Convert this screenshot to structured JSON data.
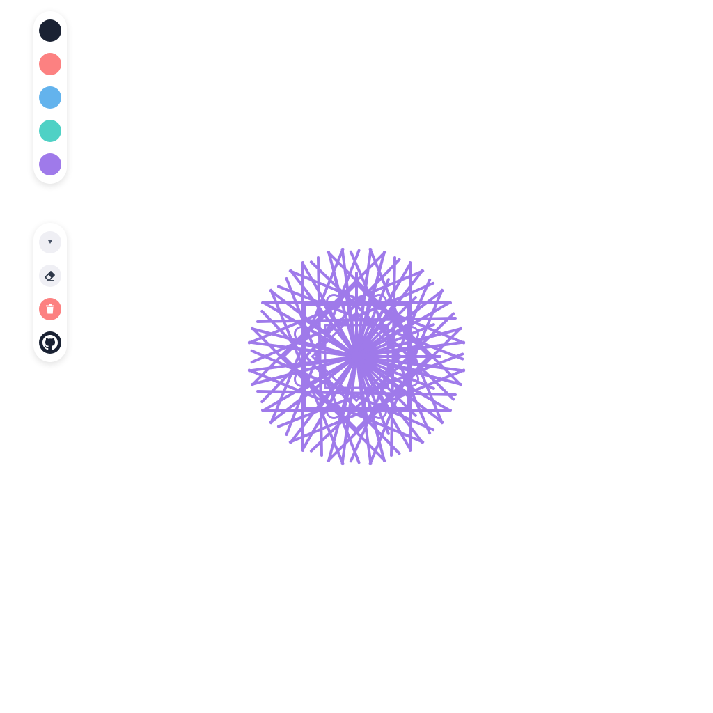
{
  "palette": {
    "colors": [
      {
        "name": "black",
        "hex": "#1a2233"
      },
      {
        "name": "red",
        "hex": "#fc8181"
      },
      {
        "name": "blue",
        "hex": "#63b3ed"
      },
      {
        "name": "teal",
        "hex": "#4fd1c5"
      },
      {
        "name": "purple",
        "hex": "#9f7aea"
      }
    ],
    "selected": "purple"
  },
  "tools": [
    {
      "name": "brush-icon",
      "bg": "#efeff4",
      "fg": "#2d3748"
    },
    {
      "name": "eraser-icon",
      "bg": "#efeff4",
      "fg": "#2d3748"
    },
    {
      "name": "trash-icon",
      "bg": "#fc8181",
      "fg": "#ffffff"
    },
    {
      "name": "github-icon",
      "bg": "#1a2233",
      "fg": "#ffffff"
    }
  ],
  "drawing": {
    "symmetry": 8,
    "stroke_color": "#9f7aea"
  }
}
